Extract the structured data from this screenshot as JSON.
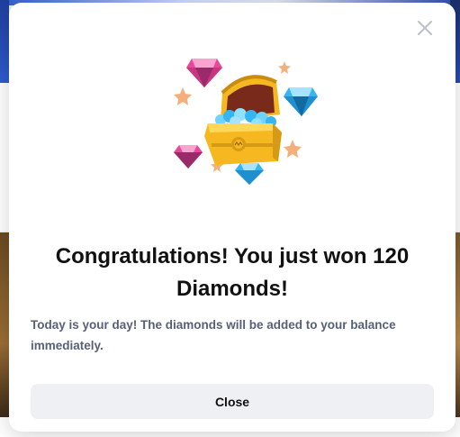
{
  "modal": {
    "title": "Congratulations! You just won 120 Diamonds!",
    "message": "Today is your day! The diamonds will be added to your balance immediately.",
    "close_button_label": "Close",
    "close_icon": "close-icon",
    "illustration": "treasure-chest-with-diamonds-illustration"
  },
  "colors": {
    "title": "#111111",
    "message": "#586077",
    "button_bg": "#eef0f3",
    "chest_gold": "#f5b821",
    "diamond_blue": "#37b4f2",
    "diamond_pink": "#e8479b",
    "star": "#f4b07c"
  }
}
